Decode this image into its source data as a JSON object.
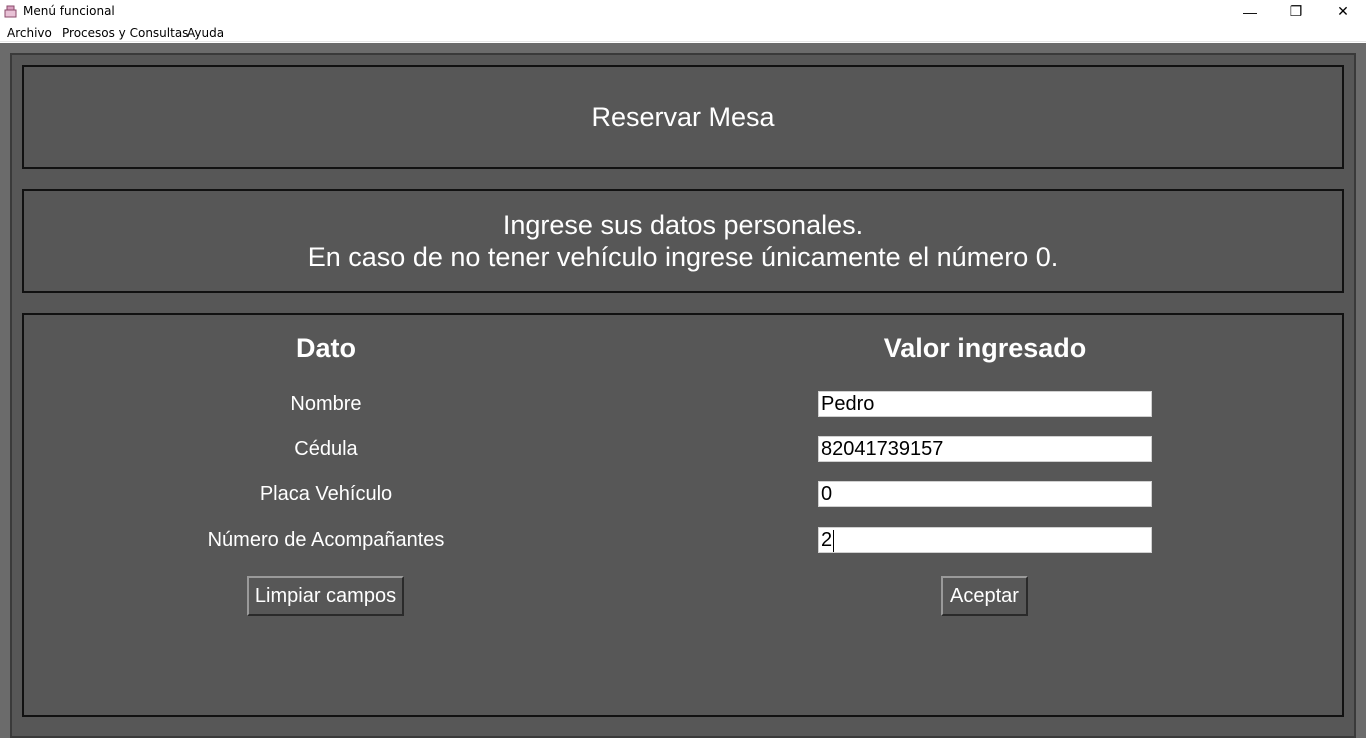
{
  "window": {
    "title": "Menú funcional",
    "minimize": "—",
    "maximize": "❐",
    "close": "✕"
  },
  "menubar": {
    "items": [
      "Archivo",
      "Procesos y Consultas",
      "Ayuda"
    ]
  },
  "header": {
    "title": "Reservar Mesa"
  },
  "instructions": {
    "line1": "Ingrese sus datos personales.",
    "line2": "En caso de no tener vehículo ingrese únicamente el número 0."
  },
  "form": {
    "col_dato": "Dato",
    "col_valor": "Valor ingresado",
    "fields": [
      {
        "label": "Nombre",
        "value": "Pedro"
      },
      {
        "label": "Cédula",
        "value": "82041739157"
      },
      {
        "label": "Placa Vehículo",
        "value": "0"
      },
      {
        "label": "Número de Acompañantes",
        "value": "2"
      }
    ],
    "clear_button": "Limpiar campos",
    "accept_button": "Aceptar"
  },
  "colors": {
    "panel_bg": "#575757",
    "outer_bg": "#6b6b6b",
    "text": "#ffffff"
  }
}
